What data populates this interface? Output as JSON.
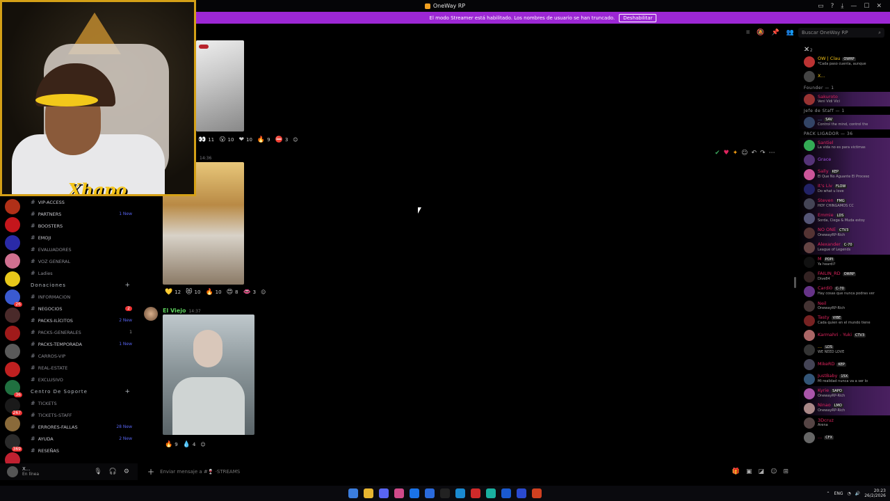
{
  "window": {
    "title": "OneWay RP",
    "controls": [
      "—",
      "☐",
      "✕"
    ]
  },
  "streamer_banner": {
    "text": "El modo Streamer está habilitado. Los nombres de usuario se han truncado.",
    "button": "Deshabilitar"
  },
  "webcam": {
    "overlay_name": "Xhapo"
  },
  "search": {
    "placeholder": "Buscar OneWay RP"
  },
  "servers": [
    {
      "color": "#b03018",
      "count": ""
    },
    {
      "color": "#c4161c",
      "count": ""
    },
    {
      "color": "#2a2aa8",
      "count": ""
    },
    {
      "color": "#d07090",
      "count": ""
    },
    {
      "color": "#e8c81a",
      "count": ""
    },
    {
      "color": "#3a5ad0",
      "count": "26"
    },
    {
      "color": "#4a2a2a",
      "count": ""
    },
    {
      "color": "#a01a1a",
      "count": ""
    },
    {
      "color": "#5a5a5a",
      "count": ""
    },
    {
      "color": "#c02020",
      "count": ""
    },
    {
      "color": "#207040",
      "count": "36"
    },
    {
      "color": "#1a1a1a",
      "count": "267"
    },
    {
      "color": "#8a6a3a",
      "count": ""
    },
    {
      "color": "#2a2a2a",
      "count": "369"
    },
    {
      "color": "#c02030",
      "count": ""
    }
  ],
  "server_new_label": "NUEVO",
  "channels": [
    {
      "type": "ch",
      "label": "VIP-ACCESS",
      "extra": ""
    },
    {
      "type": "ch",
      "label": "PARTNERS",
      "extra": "1 New"
    },
    {
      "type": "ch",
      "label": "BOOSTERS",
      "extra": ""
    },
    {
      "type": "ch",
      "label": "EMOJI",
      "extra": ""
    },
    {
      "type": "ch",
      "label": "EVALUADORES",
      "extra": "",
      "dim": true
    },
    {
      "type": "ch",
      "label": "VOZ GENERAL",
      "extra": "",
      "dim": true
    },
    {
      "type": "ch",
      "label": "Ladies",
      "extra": "",
      "dim": true
    },
    {
      "type": "cat",
      "label": "Donaciones"
    },
    {
      "type": "ch",
      "label": "INFORMACION",
      "extra": "",
      "dim": true
    },
    {
      "type": "ch",
      "label": "NEGOCIOS",
      "badge": "2"
    },
    {
      "type": "ch",
      "label": "PACKS-ILÍCITOS",
      "extra": "2 New"
    },
    {
      "type": "ch",
      "label": "PACKS-GENERALES",
      "num": "1",
      "dim": true
    },
    {
      "type": "ch",
      "label": "PACKS-TEMPORADA",
      "extra": "1 New"
    },
    {
      "type": "ch",
      "label": "CARROS-VIP",
      "extra": "",
      "dim": true
    },
    {
      "type": "ch",
      "label": "REAL-ESTATE",
      "extra": "",
      "dim": true
    },
    {
      "type": "ch",
      "label": "EXCLUSIVO",
      "extra": "",
      "dim": true
    },
    {
      "type": "cat",
      "label": "Centro De Soporte"
    },
    {
      "type": "ch",
      "label": "TICKETS",
      "extra": "",
      "dim": true
    },
    {
      "type": "ch",
      "label": "TICKETS-STAFF",
      "extra": "",
      "dim": true
    },
    {
      "type": "ch",
      "label": "ERRORES-FALLAS",
      "extra": "28 New"
    },
    {
      "type": "ch",
      "label": "AYUDA",
      "extra": "2 New"
    },
    {
      "type": "ch",
      "label": "RESEÑAS",
      "extra": ""
    }
  ],
  "user": {
    "name": "X...",
    "status": "En línea"
  },
  "chat": {
    "msg1_reactions": [
      {
        "emoji": "👀",
        "count": "11"
      },
      {
        "emoji": "😮",
        "count": "10"
      },
      {
        "emoji": "❤",
        "count": "10"
      },
      {
        "emoji": "🔥",
        "count": "9"
      },
      {
        "emoji": "⛔",
        "count": "3"
      }
    ],
    "msg2_time": "14:36",
    "msg2_reactions": [
      {
        "emoji": "💛",
        "count": "12"
      },
      {
        "emoji": "😻",
        "count": "10"
      },
      {
        "emoji": "🔥",
        "count": "10"
      },
      {
        "emoji": "😍",
        "count": "8"
      },
      {
        "emoji": "👄",
        "count": "3"
      }
    ],
    "msg3_author": "El Viejo",
    "msg3_time": "14:37",
    "msg3_reactions": [
      {
        "emoji": "🔥",
        "count": "9"
      },
      {
        "emoji": "💧",
        "count": "4"
      }
    ],
    "composer_placeholder": "Enviar mensaje a #🍷 ·STREAMS"
  },
  "members": {
    "groups": [
      {
        "label": "— 2",
        "members": [
          {
            "name": "OW | Clau",
            "status": "*Cada paso cuenta, aunque",
            "color": "#f5c518",
            "tag": "OWRP",
            "av": "#b33"
          },
          {
            "name": "X...",
            "status": "",
            "color": "#f5c518",
            "tag": "",
            "av": "#444"
          }
        ]
      },
      {
        "label": "Founder — 1",
        "members": [
          {
            "name": "Sakuroto",
            "status": "Veni Vidi Vici",
            "color": "#e0245e",
            "tag": "",
            "av": "#933",
            "boost": true
          }
        ]
      },
      {
        "label": "Jefe de Staff — 1",
        "members": [
          {
            "name": "...",
            "status": "Control the mind, control the",
            "color": "#5dade2",
            "tag": "SAV",
            "av": "#346",
            "boost": true
          }
        ]
      },
      {
        "label": "PACK LIGADOR — 36",
        "members": [
          {
            "name": "Santiel",
            "status": "La vida no es para victimas",
            "color": "#e0245e",
            "tag": "",
            "av": "#3a5",
            "boost": true
          },
          {
            "name": "Grace",
            "status": "",
            "color": "#a050e0",
            "tag": "",
            "av": "#537",
            "boost": true
          },
          {
            "name": "Sally",
            "status": "El Que No Aguante El Proceso",
            "color": "#e0245e",
            "tag": "KEP",
            "av": "#c59",
            "boost": true
          },
          {
            "name": "It's Liv",
            "status": "Do what u love",
            "color": "#e0245e",
            "tag": "FLOW",
            "av": "#226",
            "boost": true
          },
          {
            "name": "Steven",
            "status": "HOY CHINGAMOS CC",
            "color": "#e0245e",
            "tag": "FMG",
            "av": "#445",
            "boost": true
          },
          {
            "name": "Emmie",
            "status": "Sorda, Ciega & Muda estoy",
            "color": "#e0245e",
            "tag": "LDS",
            "av": "#557",
            "boost": true
          },
          {
            "name": "NO ONE",
            "status": "OnewayRP-Rich",
            "color": "#e0245e",
            "tag": "CTV3",
            "av": "#533",
            "boost": true
          },
          {
            "name": "Alexander",
            "status": "League of Legends",
            "color": "#e0245e",
            "tag": "C-70",
            "av": "#644",
            "boost": true
          },
          {
            "name": "M",
            "status": "Ya heardi?",
            "color": "#e0245e",
            "tag": "POPI",
            "av": "#111"
          },
          {
            "name": "FAILIN_RD",
            "status": "Dive84",
            "color": "#e0245e",
            "tag": "OWRP",
            "av": "#322"
          },
          {
            "name": "Cardi0",
            "status": "Hay cosas que nunca podras ver",
            "color": "#e0245e",
            "tag": "C-70",
            "av": "#638"
          },
          {
            "name": "Neil",
            "status": "OnewayRP-Rich",
            "color": "#e0245e",
            "tag": "",
            "av": "#433"
          },
          {
            "name": "Tasty",
            "status": "Cada quien en el mundo tiene",
            "color": "#e0245e",
            "tag": "VIBE",
            "av": "#722"
          },
          {
            "name": "Karmahri - Yuki",
            "status": "",
            "color": "#e0245e",
            "tag": "CTV3",
            "av": "#a66"
          },
          {
            "name": "...",
            "status": "WE NEED LOVE",
            "color": "#f5c518",
            "tag": "LDS",
            "av": "#333"
          },
          {
            "name": "MikeRD",
            "status": "",
            "color": "#e0245e",
            "tag": "KEP",
            "av": "#445"
          },
          {
            "name": "JustBaby",
            "status": "Mi realidad nunca va a ser lo",
            "color": "#e0245e",
            "tag": "15X",
            "av": "#357"
          },
          {
            "name": "Kyrie",
            "status": "OnewayRP-Rich",
            "color": "#e0245e",
            "tag": "SAPO",
            "av": "#a5a",
            "boost": true
          },
          {
            "name": "Ninao",
            "status": "OnewayRP-Rich",
            "color": "#e0245e",
            "tag": "LMO",
            "av": "#a88",
            "boost": true
          },
          {
            "name": "3Dcruz",
            "status": "Arena",
            "color": "#e0245e",
            "tag": "",
            "av": "#544"
          },
          {
            "name": "...",
            "status": "",
            "color": "#e0245e",
            "tag": "CFX",
            "av": "#666"
          }
        ]
      }
    ]
  },
  "taskbar": {
    "apps": [
      "#3b7ddd",
      "#e8b630",
      "#5865f2",
      "#d04a8a",
      "#1a73e8",
      "#2a6adc",
      "#222",
      "#1a8ad0",
      "#d02a2a",
      "#1ab0a0",
      "#1a5ad0",
      "#2a4ad0",
      "#d04020"
    ],
    "lang": "ENG",
    "time": "20:23",
    "date": "26/2/2026"
  }
}
